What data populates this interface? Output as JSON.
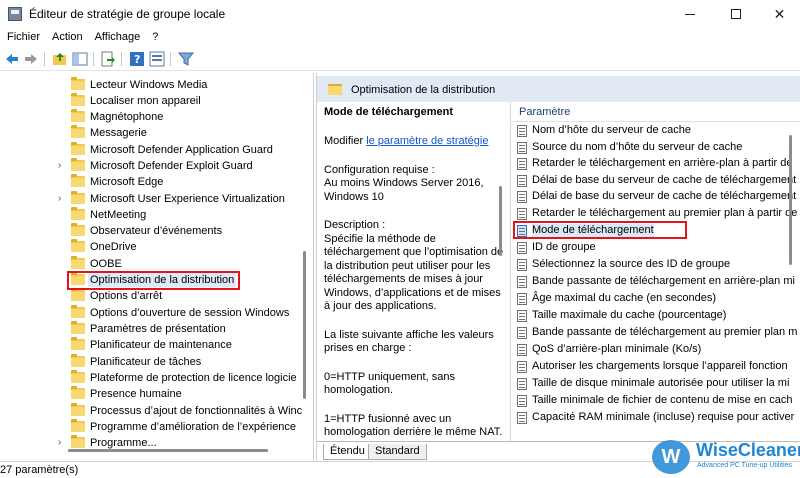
{
  "window": {
    "title": "Éditeur de stratégie de groupe locale",
    "minimize": "—",
    "close": "✕"
  },
  "menu": [
    "Fichier",
    "Action",
    "Affichage",
    "?"
  ],
  "tree": {
    "items": [
      {
        "label": "Lecteur Windows Media",
        "expandable": false
      },
      {
        "label": "Localiser mon appareil",
        "expandable": false
      },
      {
        "label": "Magnétophone",
        "expandable": false
      },
      {
        "label": "Messagerie",
        "expandable": false
      },
      {
        "label": "Microsoft Defender Application Guard",
        "expandable": false
      },
      {
        "label": "Microsoft Defender Exploit Guard",
        "expandable": true
      },
      {
        "label": "Microsoft Edge",
        "expandable": false
      },
      {
        "label": "Microsoft User Experience Virtualization",
        "expandable": true
      },
      {
        "label": "NetMeeting",
        "expandable": false
      },
      {
        "label": "Observateur d’événements",
        "expandable": false
      },
      {
        "label": "OneDrive",
        "expandable": false
      },
      {
        "label": "OOBE",
        "expandable": false
      },
      {
        "label": "Optimisation de la distribution",
        "expandable": false,
        "selected": true
      },
      {
        "label": "Options d’arrêt",
        "expandable": false
      },
      {
        "label": "Options d’ouverture de session Windows",
        "expandable": false
      },
      {
        "label": "Paramètres de présentation",
        "expandable": false
      },
      {
        "label": "Planificateur de maintenance",
        "expandable": false
      },
      {
        "label": "Planificateur de tâches",
        "expandable": false
      },
      {
        "label": "Plateforme de protection de licence logicie",
        "expandable": false
      },
      {
        "label": "Presence humaine",
        "expandable": false
      },
      {
        "label": "Processus d’ajout de fonctionnalités à Winc",
        "expandable": false
      },
      {
        "label": "Programme d’amélioration de l’expérience",
        "expandable": false
      },
      {
        "label": "Programme...",
        "expandable": true
      }
    ]
  },
  "right": {
    "header": "Optimisation de la distribution",
    "description": {
      "title": "Mode de téléchargement",
      "modify_prefix": "Modifier ",
      "modify_link": "le paramètre de stratégie",
      "config": "Configuration requise :\nAu moins Windows Server 2016, Windows 10",
      "desc": "Description :\nSpécifie la méthode de téléchargement que l’optimisation de la distribution peut utiliser pour les téléchargements de mises à jour Windows, d’applications et de mises à jour des applications.",
      "list_intro": "La liste suivante affiche les valeurs prises en charge :",
      "v0": "0=HTTP uniquement, sans homologation.",
      "v1": "1=HTTP fusionné avec un homologation derrière le même NAT."
    },
    "list_header": "Paramètre",
    "settings": [
      "Nom d’hôte du serveur de cache",
      "Source du nom d’hôte du serveur de cache",
      "Retarder le téléchargement en arrière-plan à partir de",
      "Délai de base du serveur de cache de téléchargement",
      "Délai de base du serveur de cache de téléchargement",
      "Retarder le téléchargement au premier plan à partir de",
      "Mode de téléchargement",
      "ID de groupe",
      "Sélectionnez la source des ID de groupe",
      "Bande passante de téléchargement en arrière-plan mi",
      "Âge maximal du cache (en secondes)",
      "Taille maximale du cache (pourcentage)",
      "Bande passante de téléchargement au premier plan m",
      "QoS d’arrière-plan minimale (Ko/s)",
      "Autoriser les chargements lorsque l’appareil fonction",
      "Taille de disque minimale autorisée pour utiliser la mi",
      "Taille minimale de fichier de contenu de mise en cach",
      "Capacité RAM minimale (incluse) requise pour activer"
    ],
    "selected_setting_index": 6,
    "tabs": [
      "Étendu",
      "Standard"
    ]
  },
  "status": "27 paramètre(s)",
  "watermark": {
    "logo": "W",
    "name": "WiseCleaner",
    "tagline": "Advanced PC Tune-up Utilities"
  },
  "colors": {
    "highlight_border": "#e3141b",
    "header_bg": "#e1e9f4",
    "link": "#1155cc",
    "folder": "#f8d870"
  }
}
